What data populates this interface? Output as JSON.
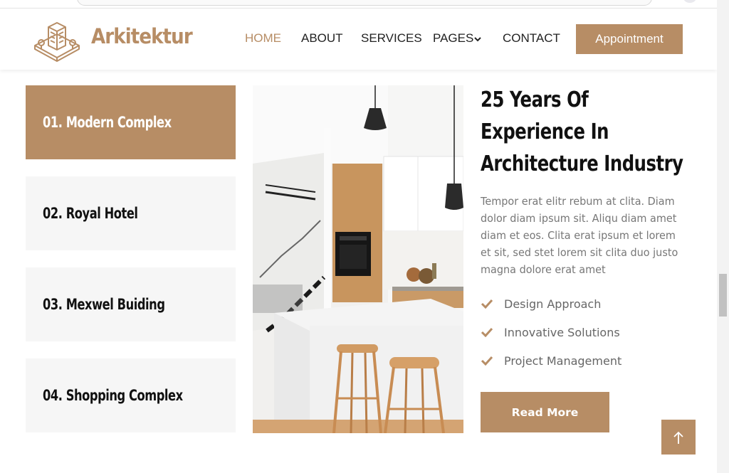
{
  "header": {
    "brand": "Arkitektur",
    "nav": [
      {
        "label": "HOME",
        "active": true
      },
      {
        "label": "ABOUT"
      },
      {
        "label": "SERVICES"
      },
      {
        "label": "PAGES"
      },
      {
        "label": "CONTACT"
      }
    ],
    "appointment_label": "Appointment"
  },
  "projects": [
    {
      "label": "01. Modern Complex",
      "active": true
    },
    {
      "label": "02. Royal Hotel"
    },
    {
      "label": "03. Mexwel Buiding"
    },
    {
      "label": "04. Shopping Complex"
    }
  ],
  "about": {
    "title_lines": [
      "25 Years Of",
      "Experience In",
      "Architecture Industry"
    ],
    "paragraph_lines": [
      "Tempor erat elitr rebum at clita. Diam",
      "dolor diam ipsum sit. Aliqu diam amet",
      "diam et eos. Clita erat ipsum et lorem",
      "et sit, sed stet lorem sit clita duo justo",
      "magna dolore erat amet"
    ],
    "features": [
      "Design Approach",
      "Innovative Solutions",
      "Project Management"
    ],
    "read_more_label": "Read More"
  },
  "icons": {
    "logo": "building-icon",
    "nav_dropdown": "chevron-down-icon",
    "feature_bullet": "check-icon",
    "back_to_top": "arrow-up-icon"
  },
  "colors": {
    "accent": "#B78D65",
    "heading": "#111111",
    "text": "#777777",
    "tile_bg": "#F6F6F6"
  }
}
